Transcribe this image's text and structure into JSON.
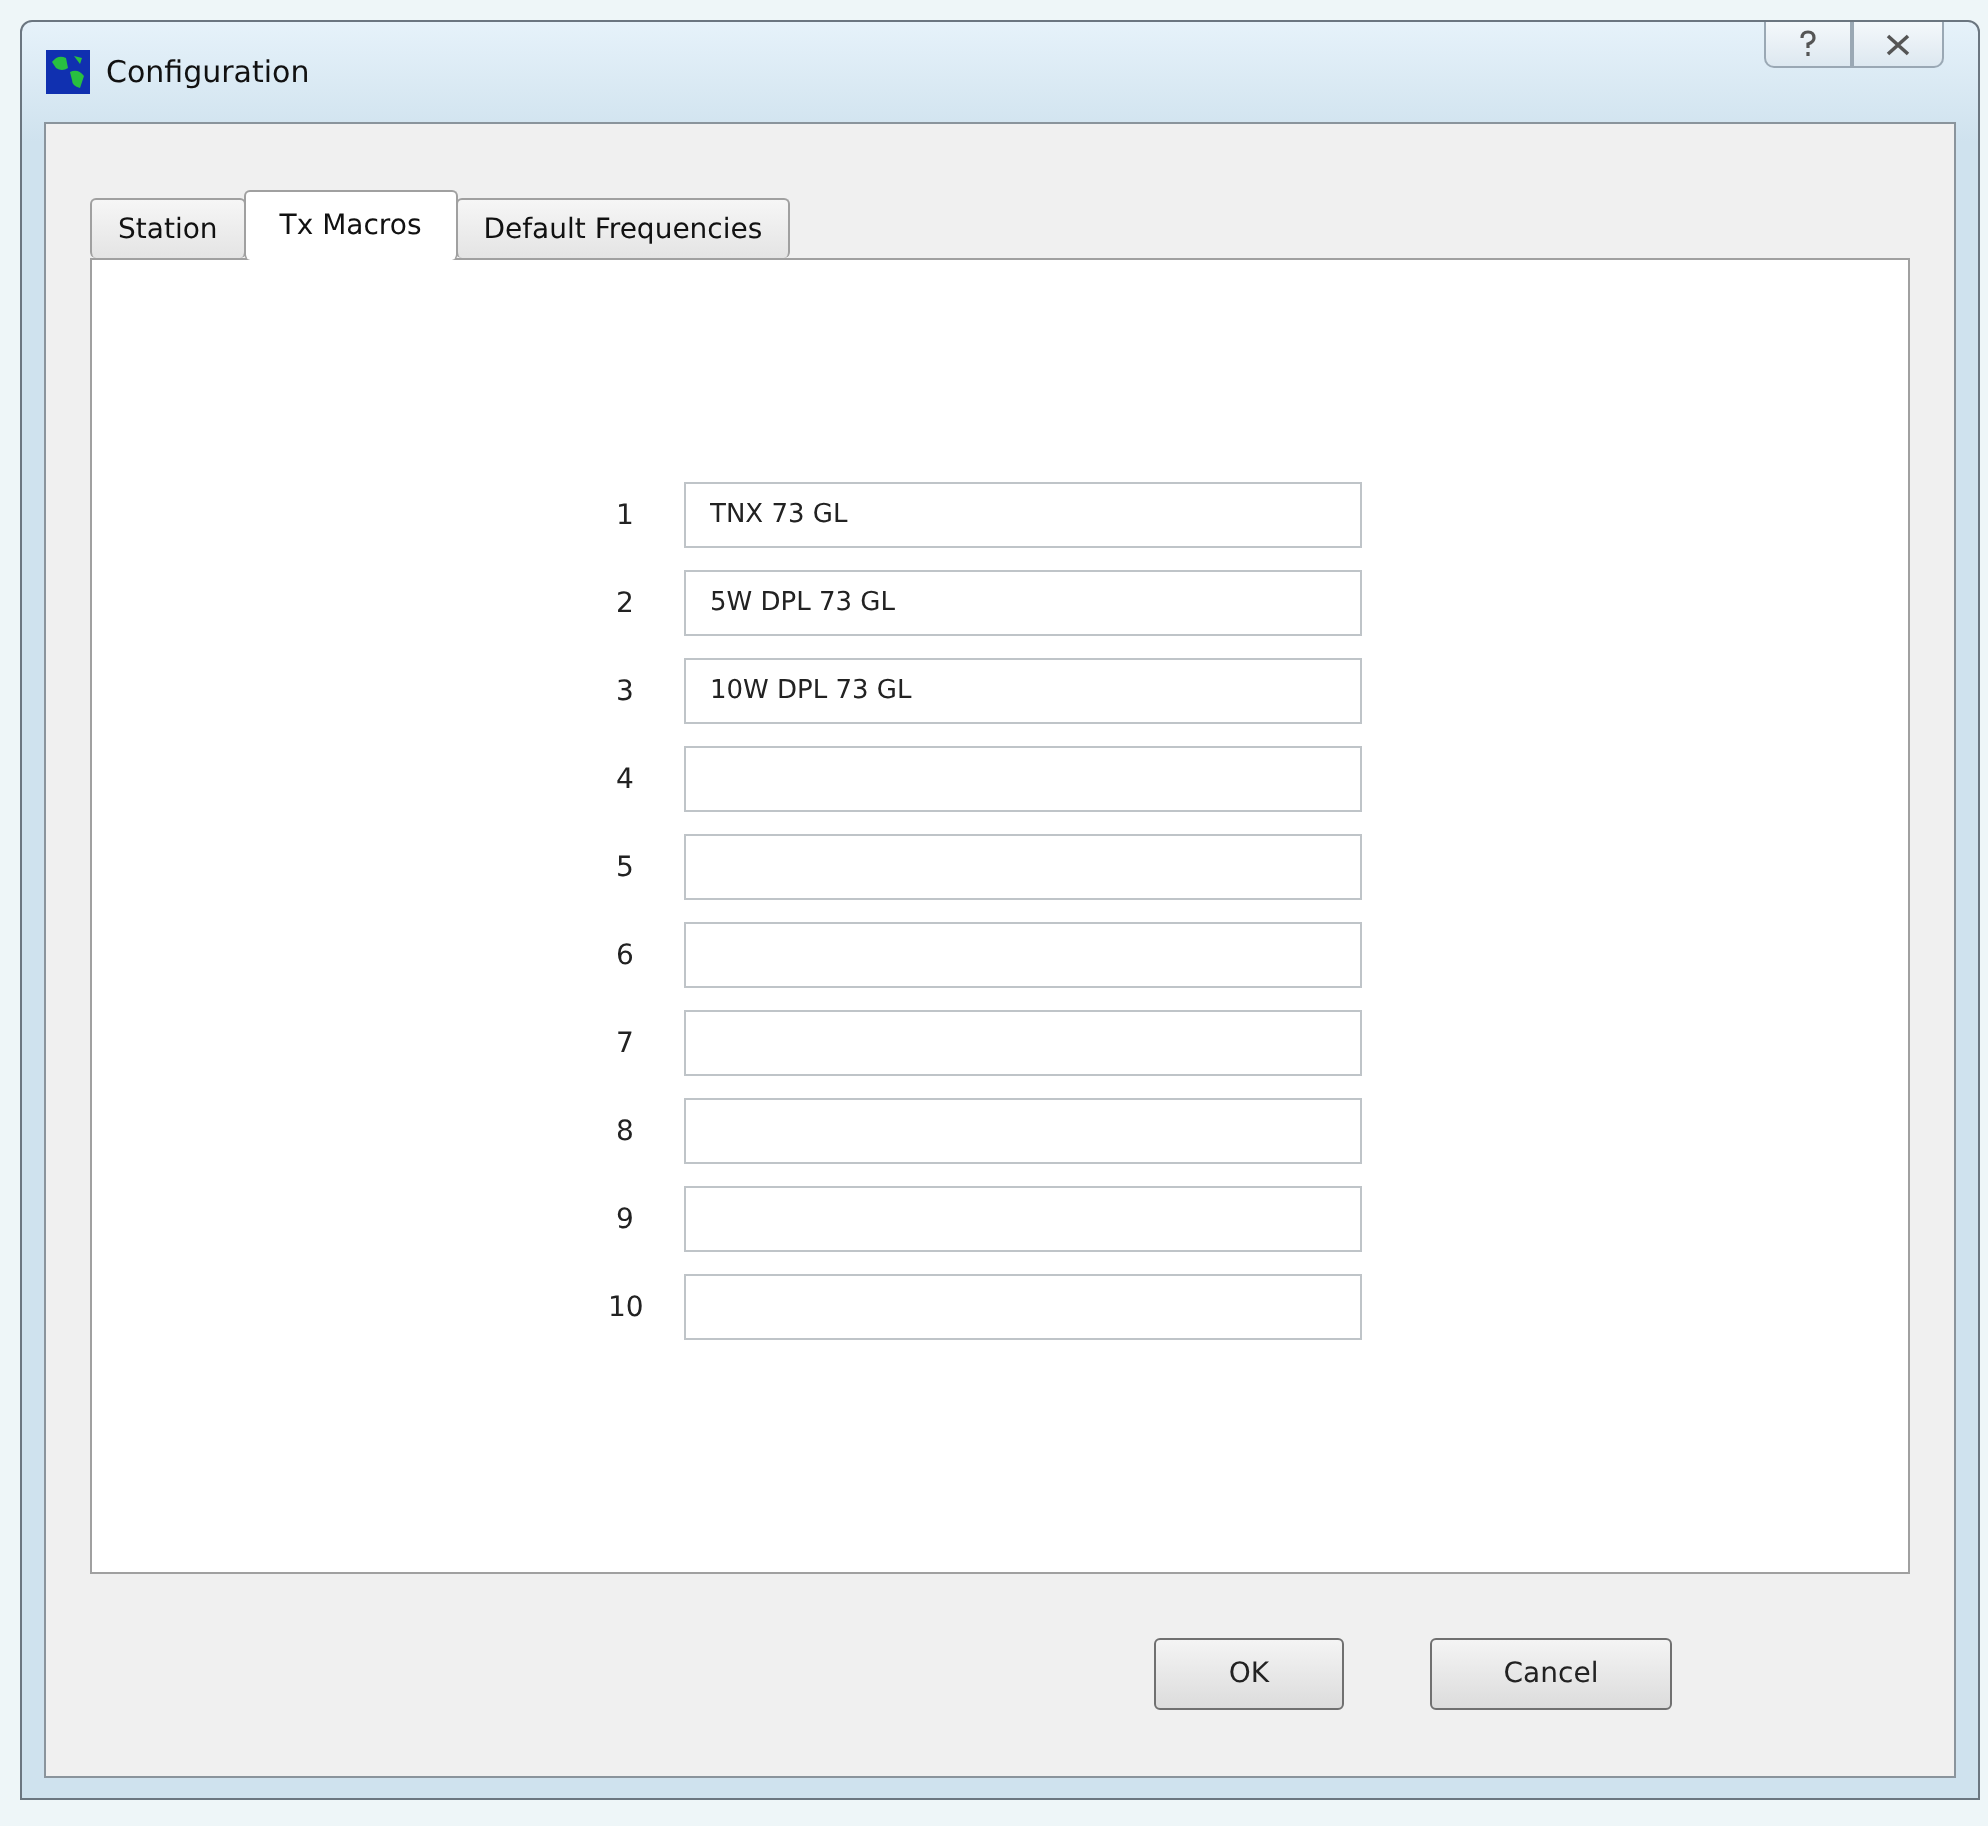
{
  "window": {
    "title": "Configuration"
  },
  "tabs": [
    {
      "label": "Station",
      "selected": false
    },
    {
      "label": "Tx Macros",
      "selected": true
    },
    {
      "label": "Default Frequencies",
      "selected": false
    }
  ],
  "macros": [
    {
      "number": "1",
      "value": "TNX 73 GL"
    },
    {
      "number": "2",
      "value": "5W DPL 73 GL"
    },
    {
      "number": "3",
      "value": "10W DPL 73 GL"
    },
    {
      "number": "4"
    },
    {
      "number": "5"
    },
    {
      "number": "6"
    },
    {
      "number": "7"
    },
    {
      "number": "8"
    },
    {
      "number": "9"
    },
    {
      "number": "10"
    }
  ],
  "buttons": [
    "OK",
    "Cancel"
  ]
}
